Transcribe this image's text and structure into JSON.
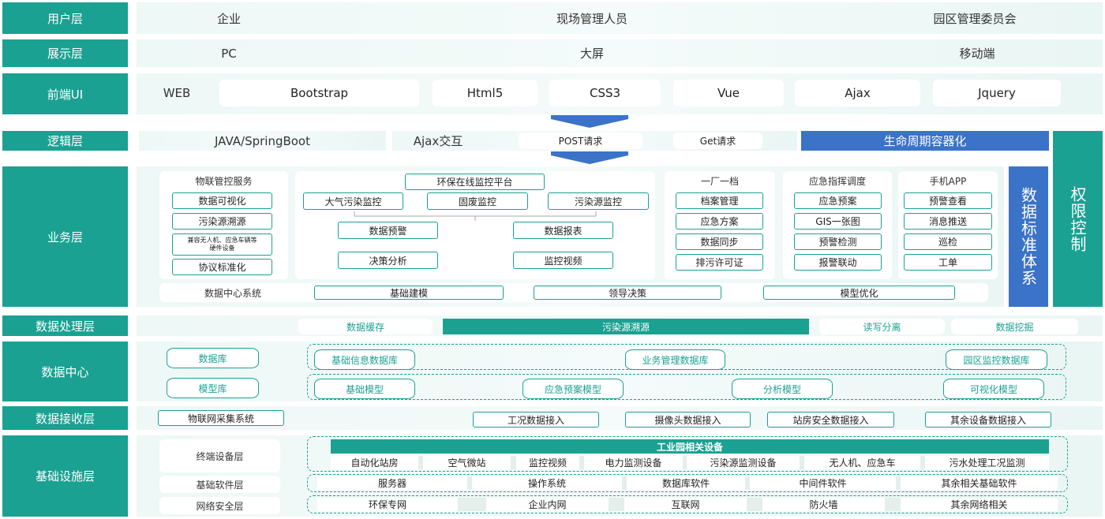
{
  "layers": {
    "user": "用户层",
    "display": "展示层",
    "frontend": "前端UI",
    "logic": "逻辑层",
    "business": "业务层",
    "processing": "数据处理层",
    "datacenter": "数据中心",
    "receive": "数据接收层",
    "infra": "基础设施层"
  },
  "user_row": [
    "企业",
    "现场管理人员",
    "园区管理委员会"
  ],
  "display_row": [
    "PC",
    "大屏",
    "移动端"
  ],
  "frontend_row": {
    "web": "WEB",
    "items": [
      "Bootstrap",
      "Html5",
      "CSS3",
      "Vue",
      "Ajax",
      "Jquery"
    ]
  },
  "logic_row": {
    "java": "JAVA/SpringBoot",
    "ajax": "Ajax交互",
    "post": "POST请求",
    "get": "Get请求",
    "lifecycle": "生命周期容器化"
  },
  "business": {
    "iot": {
      "title": "物联管控服务",
      "items": [
        "数据可视化",
        "污染源溯源",
        "兼容无人机、应急车辆等",
        "硬件设备",
        "协议标准化"
      ]
    },
    "platform": {
      "title": "环保在线监控平台",
      "row1": [
        "大气污染监控",
        "固废监控",
        "污染源监控"
      ],
      "row2": [
        "数据预警",
        "数据报表"
      ],
      "row3": [
        "决策分析",
        "监控视频"
      ]
    },
    "one_factory": {
      "title": "一厂一档",
      "items": [
        "档案管理",
        "应急方案",
        "数据同步",
        "排污许可证"
      ]
    },
    "emergency": {
      "title": "应急指挥调度",
      "items": [
        "应急预案",
        "GIS一张图",
        "预警检测",
        "报警联动"
      ]
    },
    "mobile": {
      "title": "手机APP",
      "items": [
        "预警查看",
        "消息推送",
        "巡检",
        "工单"
      ]
    },
    "bottom": {
      "label": "数据中心系统",
      "items": [
        "基础建模",
        "领导决策",
        "模型优化"
      ]
    }
  },
  "side": {
    "standards": "数据标准体系",
    "permission": "权限控制"
  },
  "processing_row": [
    "数据缓存",
    "污染源溯源",
    "读写分离",
    "数据挖掘"
  ],
  "datacenter": {
    "left": [
      "数据库",
      "模型库"
    ],
    "row1": [
      "基础信息数据库",
      "业务管理数据库",
      "园区监控数据库"
    ],
    "row2": [
      "基础模型",
      "应急预案模型",
      "分析模型",
      "可视化模型"
    ]
  },
  "receive_row": [
    "物联网采集系统",
    "工况数据接入",
    "摄像头数据接入",
    "站房安全数据接入",
    "其余设备数据接入"
  ],
  "infra": {
    "left": [
      "终端设备层",
      "基础软件层",
      "网络安全层"
    ],
    "header": "工业园相关设备",
    "devices": [
      "自动化站房",
      "空气微站",
      "监控视频",
      "电力监测设备",
      "污染源监测设备",
      "无人机、应急车",
      "污水处理工况监测"
    ],
    "software": [
      "服务器",
      "操作系统",
      "数据库软件",
      "中间件软件",
      "其余相关基础软件"
    ],
    "network": [
      "环保专网",
      "企业内网",
      "互联网",
      "防火墙",
      "其余网络相关"
    ]
  },
  "colors": {
    "teal": "#1aa192",
    "blue": "#3a73c7",
    "band": "#eef8f6"
  }
}
